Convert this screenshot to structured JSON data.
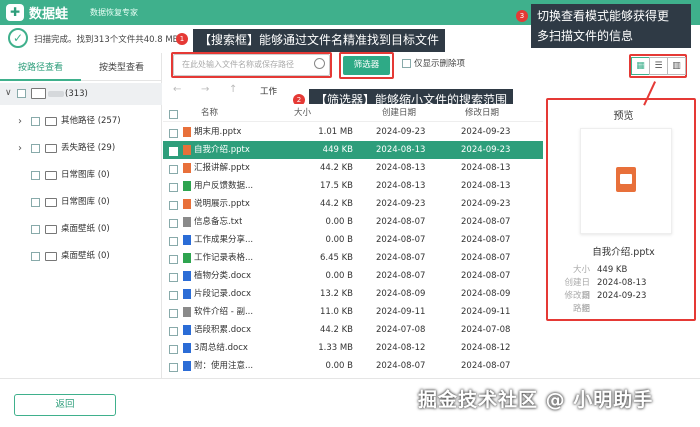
{
  "app": {
    "logo": "✚",
    "name": "数据蛙",
    "subtitle": "数据恢复专家"
  },
  "status": {
    "text": "扫描完成。找到313个文件共40.8 MB"
  },
  "sidebar": {
    "tabs": [
      "按路径查看",
      "按类型查看"
    ],
    "root": {
      "label": "(313)"
    },
    "items": [
      {
        "label": "其他路径 (257)",
        "expand": true
      },
      {
        "label": "丢失路径 (29)",
        "expand": true
      },
      {
        "label": "日常图库 (0)",
        "expand": false
      },
      {
        "label": "日常图库 (0)",
        "expand": false
      },
      {
        "label": "桌面壁纸 (0)",
        "expand": false
      },
      {
        "label": "桌面壁纸 (0)",
        "expand": false
      }
    ]
  },
  "toolbar": {
    "search_placeholder": "在此处输入文件名称或保存路径",
    "filter_label": "筛选器",
    "only_deleted_label": "仅显示删除项",
    "path_label": "工作"
  },
  "annotations": {
    "search_callout": "【搜索框】能够通过文件名精准找到目标文件",
    "filter_callout": "【筛选器】能够缩小文件的搜索范围",
    "view_callout_line1": "切换查看模式能够获得更",
    "view_callout_line2": "多扫描文件的信息",
    "badge1": "1",
    "badge2": "2",
    "badge3": "3"
  },
  "table": {
    "headers": {
      "name": "名称",
      "size": "大小",
      "created": "创建日期",
      "modified": "修改日期"
    },
    "rows": [
      {
        "name": "期末用.pptx",
        "size": "1.01 MB",
        "created": "2024-09-23",
        "modified": "2024-09-23",
        "type": "ppt",
        "selected": false
      },
      {
        "name": "自我介绍.pptx",
        "size": "449 KB",
        "created": "2024-08-13",
        "modified": "2024-09-23",
        "type": "ppt",
        "selected": true
      },
      {
        "name": "汇报讲解.pptx",
        "size": "44.2 KB",
        "created": "2024-08-13",
        "modified": "2024-08-13",
        "type": "ppt",
        "selected": false
      },
      {
        "name": "用户反馈数据...",
        "size": "17.5 KB",
        "created": "2024-08-13",
        "modified": "2024-08-13",
        "type": "xls",
        "selected": false
      },
      {
        "name": "说明展示.pptx",
        "size": "44.2 KB",
        "created": "2024-09-23",
        "modified": "2024-09-23",
        "type": "ppt",
        "selected": false
      },
      {
        "name": "信息备忘.txt",
        "size": "0.00 B",
        "created": "2024-08-07",
        "modified": "2024-08-07",
        "type": "txt",
        "selected": false
      },
      {
        "name": "工作成果分享...",
        "size": "0.00 B",
        "created": "2024-08-07",
        "modified": "2024-08-07",
        "type": "doc",
        "selected": false
      },
      {
        "name": "工作记录表格...",
        "size": "6.45 KB",
        "created": "2024-08-07",
        "modified": "2024-08-07",
        "type": "xls",
        "selected": false
      },
      {
        "name": "植物分类.docx",
        "size": "0.00 B",
        "created": "2024-08-07",
        "modified": "2024-08-07",
        "type": "doc",
        "selected": false
      },
      {
        "name": "片段记录.docx",
        "size": "13.2 KB",
        "created": "2024-08-09",
        "modified": "2024-08-09",
        "type": "doc",
        "selected": false
      },
      {
        "name": "软件介绍 - 副...",
        "size": "11.0 KB",
        "created": "2024-09-11",
        "modified": "2024-09-11",
        "type": "txt",
        "selected": false
      },
      {
        "name": "语段积累.docx",
        "size": "44.2 KB",
        "created": "2024-07-08",
        "modified": "2024-07-08",
        "type": "doc",
        "selected": false
      },
      {
        "name": "3周总结.docx",
        "size": "1.33 MB",
        "created": "2024-08-12",
        "modified": "2024-08-12",
        "type": "doc",
        "selected": false
      },
      {
        "name": "附：使用注意...",
        "size": "0.00 B",
        "created": "2024-08-07",
        "modified": "2024-08-07",
        "type": "doc",
        "selected": false
      }
    ]
  },
  "preview": {
    "title": "预览",
    "filename": "自我介绍.pptx",
    "size_label": "大小",
    "size_value": "449 KB",
    "created_label": "创建日期",
    "created_value": "2024-08-13",
    "modified_label": "修改日期",
    "modified_value": "2024-09-23",
    "path_label": "路径"
  },
  "footer": {
    "back_label": "返回",
    "watermark": "掘金技术社区 @ 小明助手"
  },
  "colors": {
    "brand": "#3fb08c",
    "selected_row": "#2e9e7b",
    "annotation_red": "#e53935",
    "ppt": "#e8703a",
    "xls": "#2ea44f",
    "doc": "#2b6cd6",
    "txt": "#8a8a8a"
  }
}
